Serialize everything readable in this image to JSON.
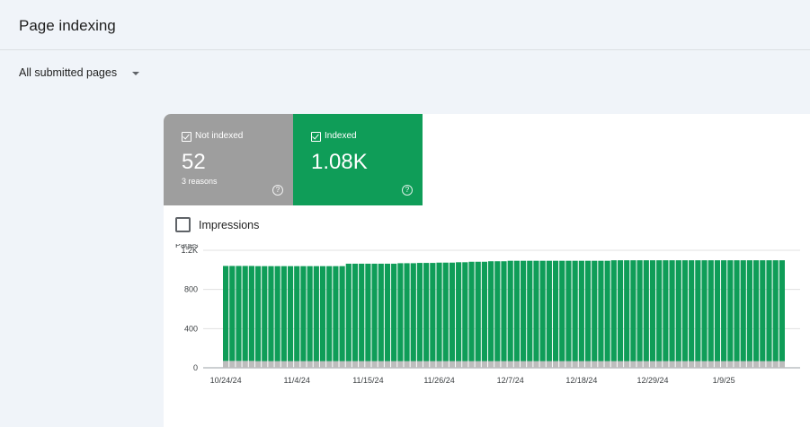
{
  "header": {
    "title": "Page indexing"
  },
  "filter": {
    "selected": "All submitted pages"
  },
  "tiles": {
    "not_indexed": {
      "label": "Not indexed",
      "value": "52",
      "sub": "3 reasons"
    },
    "indexed": {
      "label": "Indexed",
      "value": "1.08K"
    }
  },
  "impressions": {
    "label": "Impressions"
  },
  "colors": {
    "indexed": "#0f9d58",
    "not_indexed": "#bdbdbd",
    "not_indexed_tile": "#9e9e9e"
  },
  "chart_data": {
    "type": "bar",
    "stacked": true,
    "ylabel": "Pages",
    "ylim": [
      0,
      1200
    ],
    "yticks": [
      0,
      400,
      800,
      1200
    ],
    "ytick_labels": [
      "0",
      "400",
      "800",
      "1.2K"
    ],
    "xtick_labels": [
      "10/24/24",
      "11/4/24",
      "11/15/24",
      "11/26/24",
      "12/7/24",
      "12/18/24",
      "12/29/24",
      "1/9/25"
    ],
    "xtick_positions": [
      0,
      11,
      22,
      33,
      44,
      55,
      66,
      77
    ],
    "grid": true,
    "series": [
      {
        "values": [
          70,
          70,
          70,
          70,
          70,
          68,
          68,
          68,
          68,
          68,
          68,
          68,
          68,
          68,
          68,
          68,
          68,
          68,
          68,
          68,
          68,
          68,
          68,
          68,
          68,
          68,
          68,
          68,
          68,
          68,
          68,
          68,
          68,
          68,
          68,
          68,
          68,
          68,
          68,
          68,
          68,
          68,
          68,
          68,
          68,
          68,
          68,
          68,
          68,
          68,
          68,
          68,
          68,
          68,
          68,
          68,
          68,
          68,
          68,
          68,
          68,
          68,
          68,
          68,
          68,
          68,
          68,
          68,
          68,
          68,
          68,
          68,
          68,
          68,
          68,
          68,
          68,
          68,
          68,
          68,
          68,
          68,
          68,
          68,
          68,
          68,
          68
        ]
      },
      {
        "values": [
          970,
          970,
          970,
          970,
          970,
          970,
          970,
          970,
          970,
          970,
          970,
          970,
          970,
          970,
          970,
          970,
          970,
          970,
          970,
          995,
          995,
          995,
          995,
          995,
          995,
          995,
          995,
          1000,
          1000,
          1000,
          1003,
          1003,
          1003,
          1006,
          1006,
          1006,
          1010,
          1010,
          1015,
          1015,
          1015,
          1020,
          1020,
          1020,
          1025,
          1025,
          1025,
          1025,
          1025,
          1025,
          1025,
          1025,
          1025,
          1025,
          1025,
          1025,
          1025,
          1025,
          1025,
          1025,
          1030,
          1030,
          1030,
          1030,
          1030,
          1030,
          1030,
          1030,
          1030,
          1030,
          1030,
          1030,
          1030,
          1030,
          1030,
          1030,
          1030,
          1030,
          1030,
          1030,
          1030,
          1030,
          1030,
          1030,
          1030,
          1030,
          1030,
          1030,
          1030
        ]
      }
    ]
  }
}
